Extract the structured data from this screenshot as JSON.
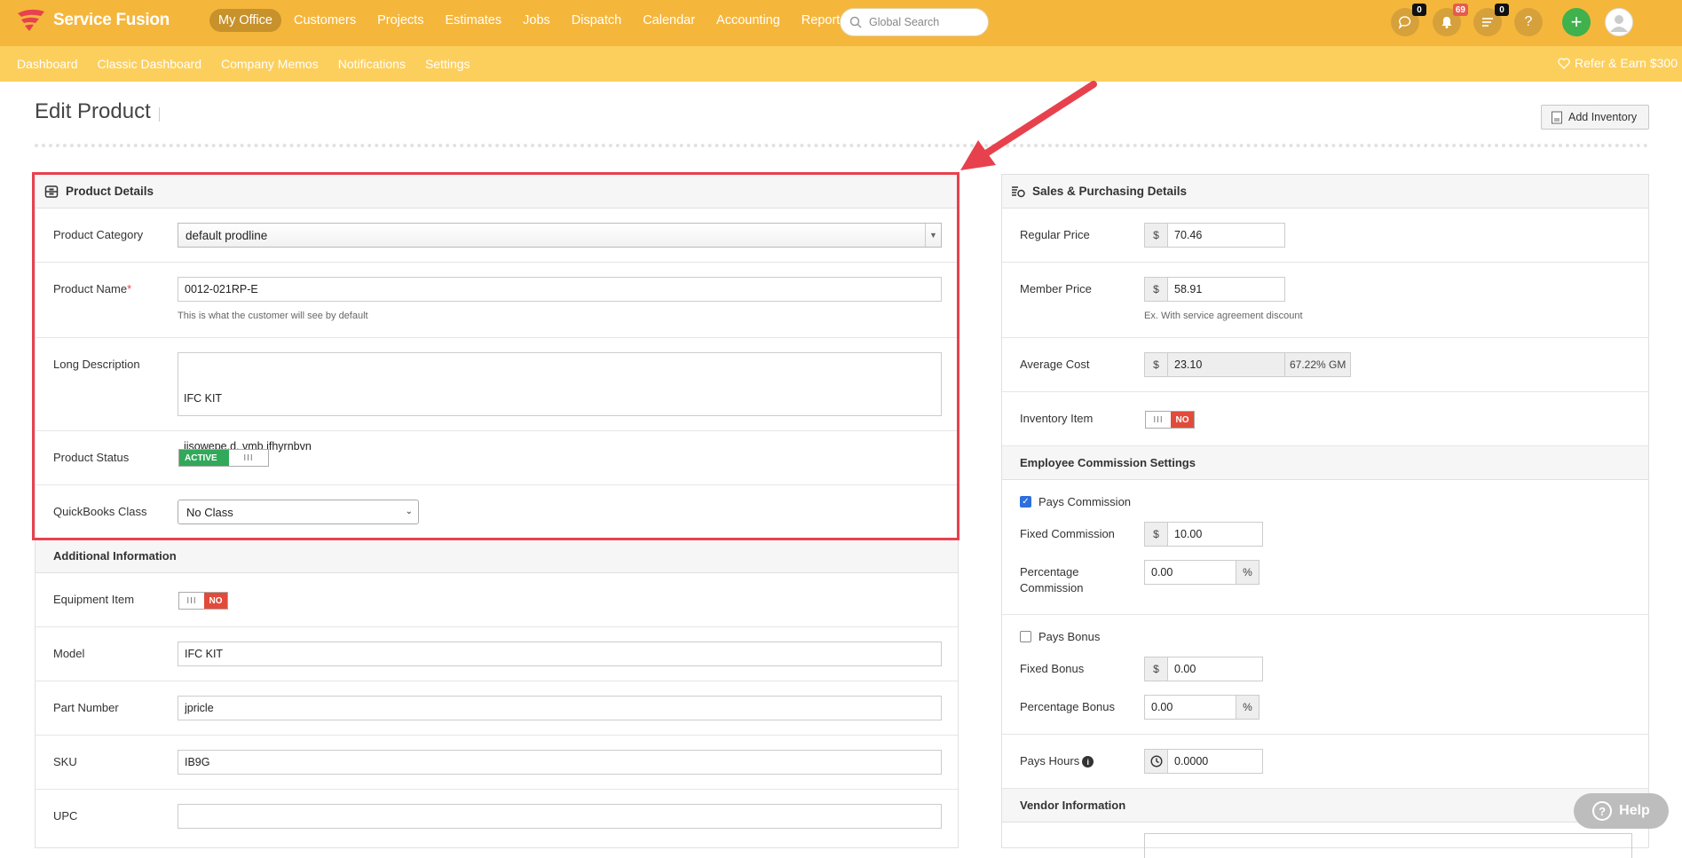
{
  "app": {
    "name": "Service Fusion"
  },
  "nav": {
    "items": [
      "My Office",
      "Customers",
      "Projects",
      "Estimates",
      "Jobs",
      "Dispatch",
      "Calendar",
      "Accounting",
      "Reports"
    ],
    "active": "My Office"
  },
  "search": {
    "placeholder": "Global Search"
  },
  "header_icons": {
    "chat_count": "0",
    "notif_count": "69",
    "tasks_count": "0",
    "help": "?",
    "add": "+"
  },
  "subnav": {
    "items": [
      "Dashboard",
      "Classic Dashboard",
      "Company Memos",
      "Notifications",
      "Settings"
    ],
    "refer": "Refer & Earn $300"
  },
  "page": {
    "title": "Edit Product",
    "add_inventory": "Add Inventory"
  },
  "product_details": {
    "title": "Product Details",
    "category_label": "Product Category",
    "category_value": "default prodline",
    "name_label": "Product Name",
    "name_required": "*",
    "name_value": "0012-021RP-E",
    "name_help": "This is what the customer will see by default",
    "desc_label": "Long Description",
    "desc_line1": "IFC KIT",
    "desc_line2": "iisowepe.d, vmb jfhyrnbvn",
    "status_label": "Product Status",
    "status_value": "ACTIVE",
    "status_grip": "III",
    "qb_label": "QuickBooks Class",
    "qb_value": "No Class"
  },
  "additional_info": {
    "title": "Additional Information",
    "equipment_label": "Equipment Item",
    "equipment_value": "NO",
    "equipment_grip": "III",
    "model_label": "Model",
    "model_value": "IFC KIT",
    "part_label": "Part Number",
    "part_value": "jpricle",
    "sku_label": "SKU",
    "sku_value": "IB9G",
    "upc_label": "UPC",
    "upc_value": ""
  },
  "sales": {
    "title": "Sales & Purchasing Details",
    "currency": "$",
    "regular_label": "Regular Price",
    "regular_value": "70.46",
    "member_label": "Member Price",
    "member_value": "58.91",
    "member_help": "Ex. With service agreement discount",
    "avgcost_label": "Average Cost",
    "avgcost_value": "23.10",
    "gm": "67.22% GM",
    "inventory_label": "Inventory Item",
    "inventory_value": "NO",
    "inventory_grip": "III"
  },
  "commission": {
    "title": "Employee Commission Settings",
    "pays_commission": "Pays Commission",
    "pays_commission_checked": true,
    "fixed_label": "Fixed Commission",
    "fixed_value": "10.00",
    "pct_label_1": "Percentage",
    "pct_label_2": "Commission",
    "pct_value": "0.00",
    "pct_sign": "%",
    "pays_bonus": "Pays Bonus",
    "pays_bonus_checked": false,
    "fixed_bonus_label": "Fixed Bonus",
    "fixed_bonus_value": "0.00",
    "pct_bonus_label": "Percentage Bonus",
    "pct_bonus_value": "0.00",
    "hours_label": "Pays Hours",
    "hours_value": "0.0000"
  },
  "vendor": {
    "title": "Vendor Information"
  },
  "help_button": {
    "label": "Help"
  }
}
